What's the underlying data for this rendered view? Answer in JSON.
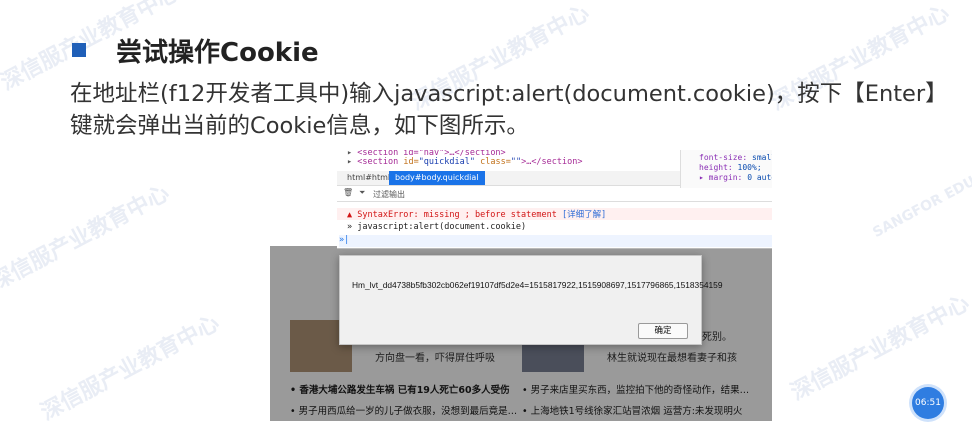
{
  "slide": {
    "title": "尝试操作Cookie",
    "body_line1": "在地址栏(f12开发者工具中)输入javascript:alert(document.cookie)，按下【Enter】",
    "body_line2": "键就会弹出当前的Cookie信息，如下图所示。"
  },
  "watermark": {
    "line1": "深信服产业教育中心",
    "line2": "SANGFOR EDUCATION CENTER"
  },
  "devtools": {
    "code_line1_tag": "<section id=\"nav\">",
    "code_line1_rest": "…</section>",
    "code_line2_open": "<section",
    "code_line2_attr": "id=",
    "code_line2_id": "\"quickdial\"",
    "code_line2_cattr": "class=",
    "code_line2_class": "\"\"",
    "code_line2_rest": ">…</section>",
    "css_line1_prop": "font-size:",
    "css_line1_val": "small",
    "css_line2_prop": "height:",
    "css_line2_val": "100%;",
    "css_line3_prop": "margin:",
    "css_line3_val": "0 auto;",
    "crumb_html": "html#html",
    "crumb_body": "body#body.quickdial",
    "filter_label": "过滤输出",
    "syntax_error": "SyntaxError: missing ; before statement",
    "error_link": "[详细了解]",
    "command": "javascript:alert(document.cookie)"
  },
  "dialog": {
    "message": "Hm_lvt_dd4738b5fb302cb062ef19107df5d2e4=1515817922,1515908697,1517796865,1518354159",
    "ok_label": "确定"
  },
  "page_fragment": {
    "caption_left": "方向盘一看，吓得屏住呼吸",
    "caption_right_top": "死别。",
    "caption_right": "林生就说现在最想看妻子和孩",
    "news": [
      "香港大埔公路发生车祸 已有19人死亡60多人受伤",
      "男子来店里买东西，监控拍下他的奇怪动作，结果…",
      "男子用西瓜给一岁的儿子做衣服，没想到最后竟是…",
      "上海地铁1号线徐家汇站冒浓烟 运营方:未发现明火"
    ]
  },
  "time_badge": "06:51"
}
